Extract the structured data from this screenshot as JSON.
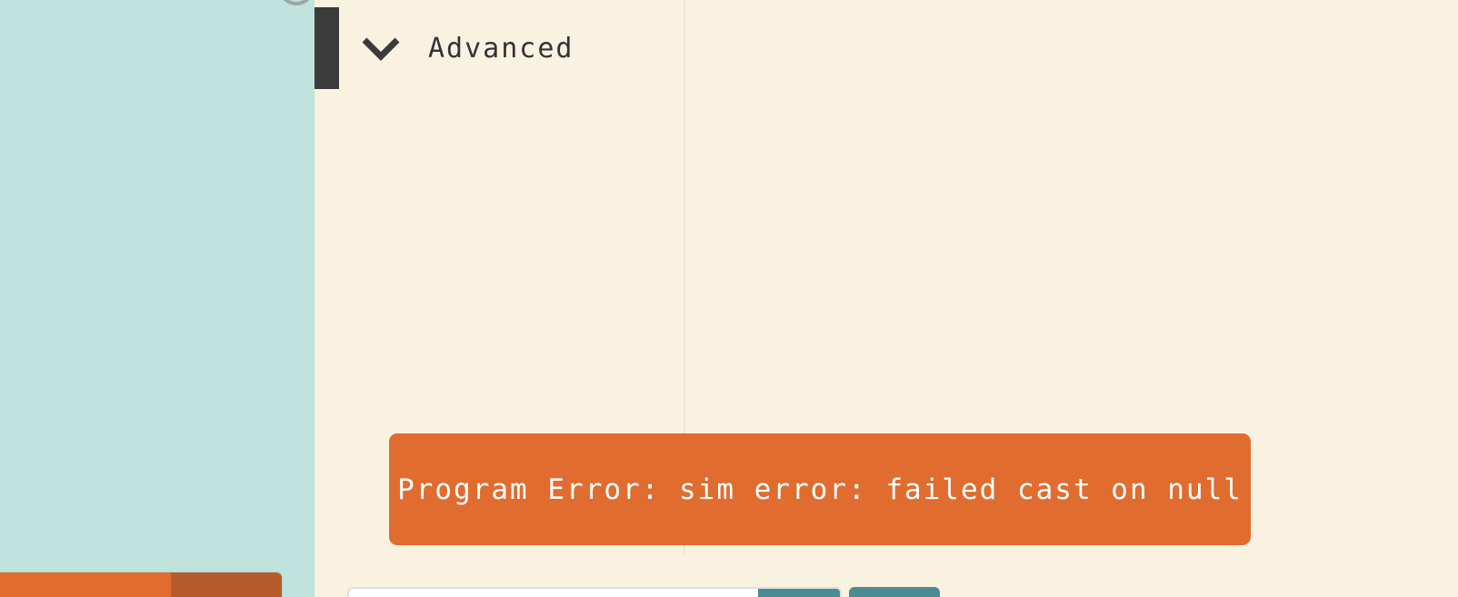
{
  "toolbox": {
    "category_label": "Advanced"
  },
  "error": {
    "message": "Program Error: sim error: failed cast on null"
  },
  "icons": {
    "category": "chevron-down-icon"
  },
  "colors": {
    "sim_background": "#bfe3dc",
    "editor_background": "#faf2e0",
    "error_background": "#e06c30",
    "category_bar": "#3b3b3b",
    "button_teal": "#4a8b94"
  }
}
